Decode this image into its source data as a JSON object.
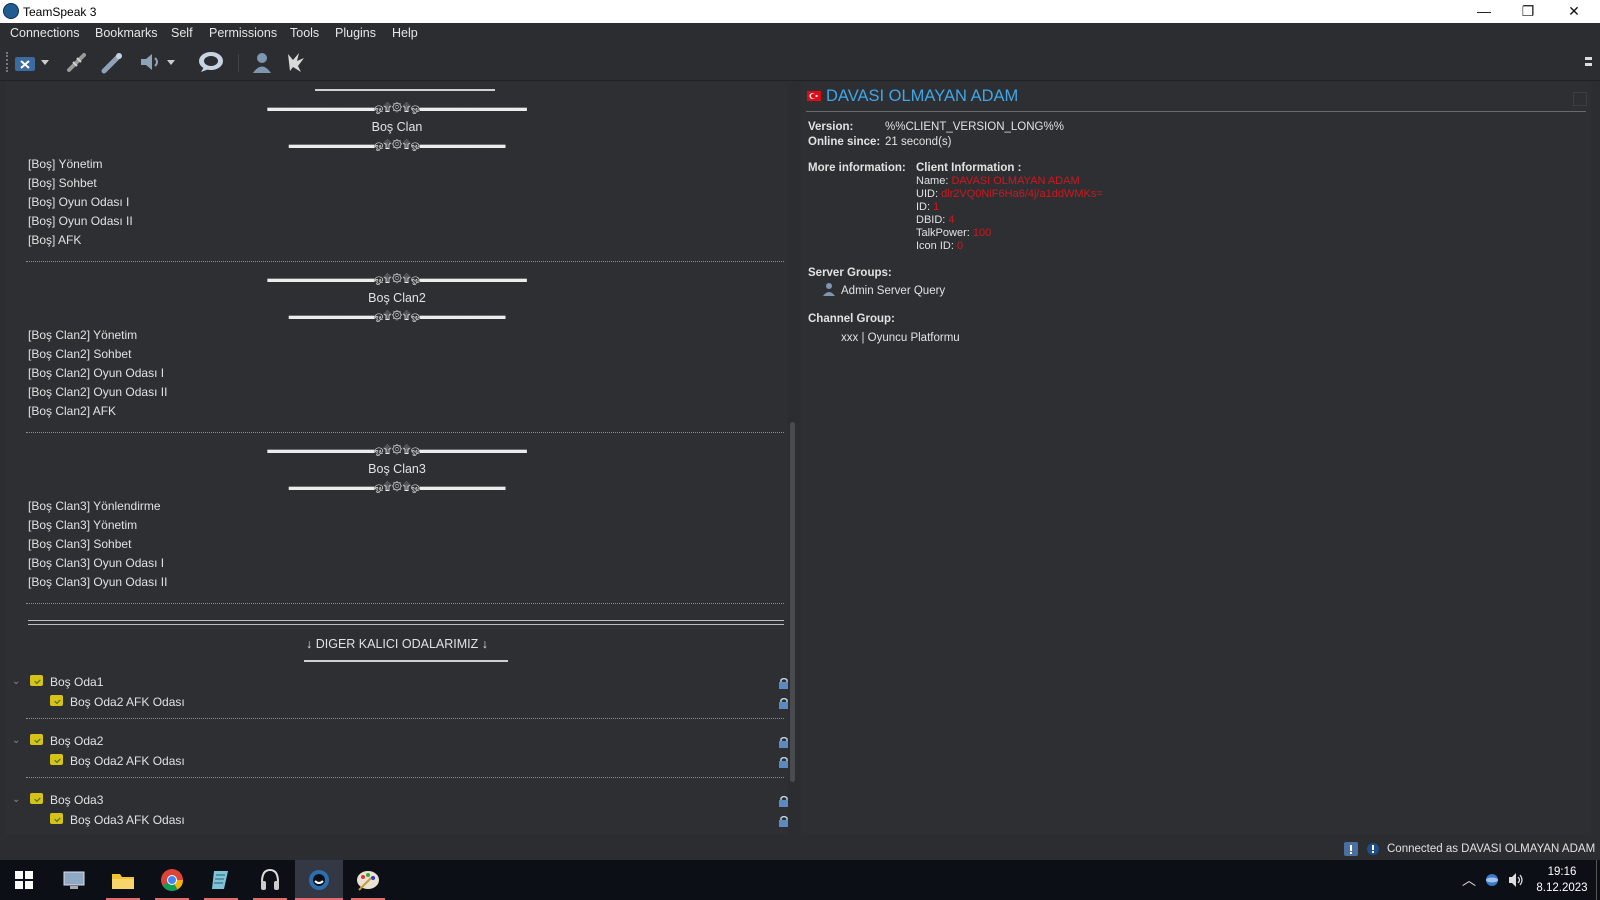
{
  "window": {
    "title": "TeamSpeak 3",
    "minimize": "—",
    "restore": "❐",
    "close": "✕"
  },
  "menu": [
    "Connections",
    "Bookmarks",
    "Self",
    "Permissions",
    "Tools",
    "Plugins",
    "Help"
  ],
  "toolbar": {
    "buttons": [
      "disconnect",
      "connect",
      "subscribe",
      "away",
      "whisper",
      "contacts",
      "avatar",
      "capture"
    ]
  },
  "tree": {
    "deco_wide": "▬▬▬▬▬▬▬▬▬▬ஓ۩۞۩ஓ▬▬▬▬▬▬▬▬▬▬",
    "deco_narrow": "▬▬▬▬▬▬▬▬ஓ۩۞۩ஓ▬▬▬▬▬▬▬▬",
    "clans": [
      {
        "name": "Boş Clan",
        "channels": [
          "[Boş] Yönetim",
          "[Boş] Sohbet",
          "[Boş] Oyun Odası I",
          "[Boş] Oyun Odası II",
          "[Boş] AFK"
        ]
      },
      {
        "name": "Boş Clan2",
        "channels": [
          "[Boş Clan2] Yönetim",
          "[Boş Clan2] Sohbet",
          "[Boş Clan2] Oyun Odası I",
          "[Boş Clan2] Oyun Odası II",
          "[Boş Clan2] AFK"
        ]
      },
      {
        "name": "Boş Clan3",
        "channels": [
          "[Boş Clan3] Yönlendirme",
          "[Boş Clan3] Yönetim",
          "[Boş Clan3] Sohbet",
          "[Boş Clan3] Oyun Odası I",
          "[Boş Clan3] Oyun Odası II"
        ]
      }
    ],
    "other_header": "↓ DIGER KALICI ODALARIMIZ ↓",
    "rooms": [
      {
        "name": "Boş Oda1",
        "sub": "Boş Oda2 AFK Odası"
      },
      {
        "name": "Boş Oda2",
        "sub": "Boş Oda2 AFK Odası"
      },
      {
        "name": "Boş Oda3",
        "sub": "Boş Oda3 AFK Odası"
      }
    ]
  },
  "info": {
    "client_name": "DAVASI OLMAYAN ADAM",
    "version_label": "Version:",
    "version_value": "%%CLIENT_VERSION_LONG%%",
    "online_label": "Online since:",
    "online_value": "21 second(s)",
    "more_label": "More information:",
    "client_info_title": "Client Information :",
    "fields": [
      {
        "label": "Name:",
        "value": "DAVASI OLMAYAN ADAM"
      },
      {
        "label": "UID:",
        "value": "dlr2VQ0NiF6Ha6/4j/a1ddWMKs="
      },
      {
        "label": "ID:",
        "value": "1"
      },
      {
        "label": "DBID:",
        "value": "4"
      },
      {
        "label": "TalkPower:",
        "value": "100"
      },
      {
        "label": "Icon ID:",
        "value": "0"
      }
    ],
    "server_groups_label": "Server Groups:",
    "server_group": "Admin Server Query",
    "channel_group_label": "Channel Group:",
    "channel_group": "xxx | Oyuncu Platformu"
  },
  "status": {
    "text": "Connected as DAVASI OLMAYAN ADAM"
  },
  "taskbar": {
    "apps": [
      "start",
      "task-view",
      "file-explorer",
      "chrome",
      "notepad",
      "headset-app",
      "teamspeak",
      "paint"
    ],
    "time": "19:16",
    "date": "8.12.2023"
  },
  "colors": {
    "background": "#2e2f33",
    "accent": "#3ea7ea",
    "value_red": "#d0171b"
  }
}
